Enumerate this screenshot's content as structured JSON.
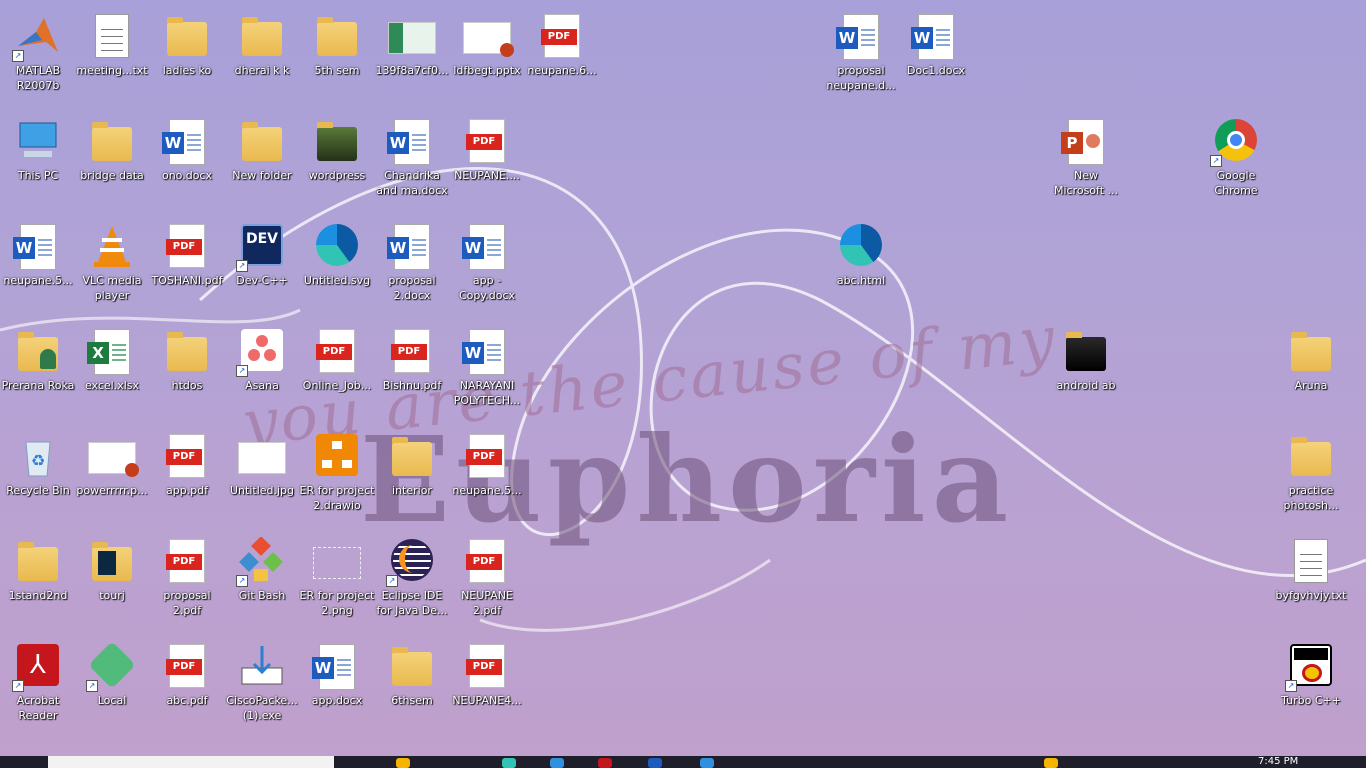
{
  "wallpaper": {
    "script_text": "you are the cause of my",
    "big_text": "Euphoria"
  },
  "icons": [
    {
      "label": "MATLAB R2007b",
      "icon": "matlab-icon"
    },
    {
      "label": "meeting...txt",
      "icon": "text-file-icon"
    },
    {
      "label": "ladies ko",
      "icon": "folder-icon"
    },
    {
      "label": "dherai k k",
      "icon": "folder-icon"
    },
    {
      "label": "5th sem",
      "icon": "folder-icon"
    },
    {
      "label": "139f8a7cf0...",
      "icon": "image-thumbnail-icon"
    },
    {
      "label": "ldfbegt.pptx",
      "icon": "powerpoint-file-icon"
    },
    {
      "label": "neupane.6...",
      "icon": "pdf-file-icon"
    },
    {
      "label": "proposal neupane.d...",
      "icon": "word-file-icon"
    },
    {
      "label": "Doc1.docx",
      "icon": "word-file-icon"
    },
    {
      "label": "This PC",
      "icon": "computer-icon"
    },
    {
      "label": "bridge data",
      "icon": "folder-icon"
    },
    {
      "label": "ono.docx",
      "icon": "word-file-icon"
    },
    {
      "label": "New folder",
      "icon": "folder-icon"
    },
    {
      "label": "wordpress",
      "icon": "folder-icon"
    },
    {
      "label": "Chandrika and ma.docx",
      "icon": "word-file-icon"
    },
    {
      "label": "NEUPANE....",
      "icon": "pdf-file-icon"
    },
    {
      "label": "New Microsoft ...",
      "icon": "powerpoint-file-icon"
    },
    {
      "label": "Google Chrome",
      "icon": "chrome-icon"
    },
    {
      "label": "neupane.5...",
      "icon": "word-file-icon"
    },
    {
      "label": "VLC media player",
      "icon": "vlc-icon"
    },
    {
      "label": "TOSHANI.pdf",
      "icon": "pdf-file-icon"
    },
    {
      "label": "Dev-C++",
      "icon": "dev-cpp-icon"
    },
    {
      "label": "Untitled.svg",
      "icon": "edge-icon"
    },
    {
      "label": "proposal 2.docx",
      "icon": "word-file-icon"
    },
    {
      "label": "app - Copy.docx",
      "icon": "word-file-icon"
    },
    {
      "label": "abc.html",
      "icon": "edge-icon"
    },
    {
      "label": "Prerana Roka",
      "icon": "user-folder-icon"
    },
    {
      "label": "excel.xlsx",
      "icon": "excel-file-icon"
    },
    {
      "label": "htdos",
      "icon": "folder-icon"
    },
    {
      "label": "Asana",
      "icon": "asana-icon"
    },
    {
      "label": "Online_Job...",
      "icon": "pdf-file-icon"
    },
    {
      "label": "Bishnu.pdf",
      "icon": "pdf-file-icon"
    },
    {
      "label": "NARAYANI POLYTECH...",
      "icon": "word-file-icon"
    },
    {
      "label": "android ab",
      "icon": "folder-icon"
    },
    {
      "label": "Aruna",
      "icon": "folder-icon"
    },
    {
      "label": "Recycle Bin",
      "icon": "recycle-bin-icon"
    },
    {
      "label": "powerrrrr.p...",
      "icon": "powerpoint-file-icon"
    },
    {
      "label": "app.pdf",
      "icon": "pdf-file-icon"
    },
    {
      "label": "Untitled.jpg",
      "icon": "image-thumbnail-icon"
    },
    {
      "label": "ER for project 2.drawio",
      "icon": "drawio-icon"
    },
    {
      "label": "interior",
      "icon": "folder-icon"
    },
    {
      "label": "neupane.5...",
      "icon": "pdf-file-icon"
    },
    {
      "label": "practice photosh...",
      "icon": "folder-icon"
    },
    {
      "label": "1stand2nd",
      "icon": "folder-icon"
    },
    {
      "label": "tourj",
      "icon": "folder-icon"
    },
    {
      "label": "proposal 2.pdf",
      "icon": "pdf-file-icon"
    },
    {
      "label": "Git Bash",
      "icon": "git-bash-icon"
    },
    {
      "label": "ER for project 2.png",
      "icon": "image-thumbnail-icon"
    },
    {
      "label": "Eclipse IDE for Java De...",
      "icon": "eclipse-icon"
    },
    {
      "label": "NEUPANE 2.pdf",
      "icon": "pdf-file-icon"
    },
    {
      "label": "byfgvhvjy.txt",
      "icon": "text-file-icon"
    },
    {
      "label": "Acrobat Reader",
      "icon": "acrobat-icon"
    },
    {
      "label": "Local",
      "icon": "local-app-icon"
    },
    {
      "label": "abc.pdf",
      "icon": "pdf-file-icon"
    },
    {
      "label": "CiscoPacke... (1).exe",
      "icon": "installer-icon"
    },
    {
      "label": "app.docx",
      "icon": "word-file-icon"
    },
    {
      "label": "6thsem",
      "icon": "folder-icon"
    },
    {
      "label": "NEUPANE4...",
      "icon": "pdf-file-icon"
    },
    {
      "label": "Turbo C++",
      "icon": "turbo-cpp-icon"
    }
  ],
  "taskbar": {
    "clock": "7:45 PM"
  }
}
